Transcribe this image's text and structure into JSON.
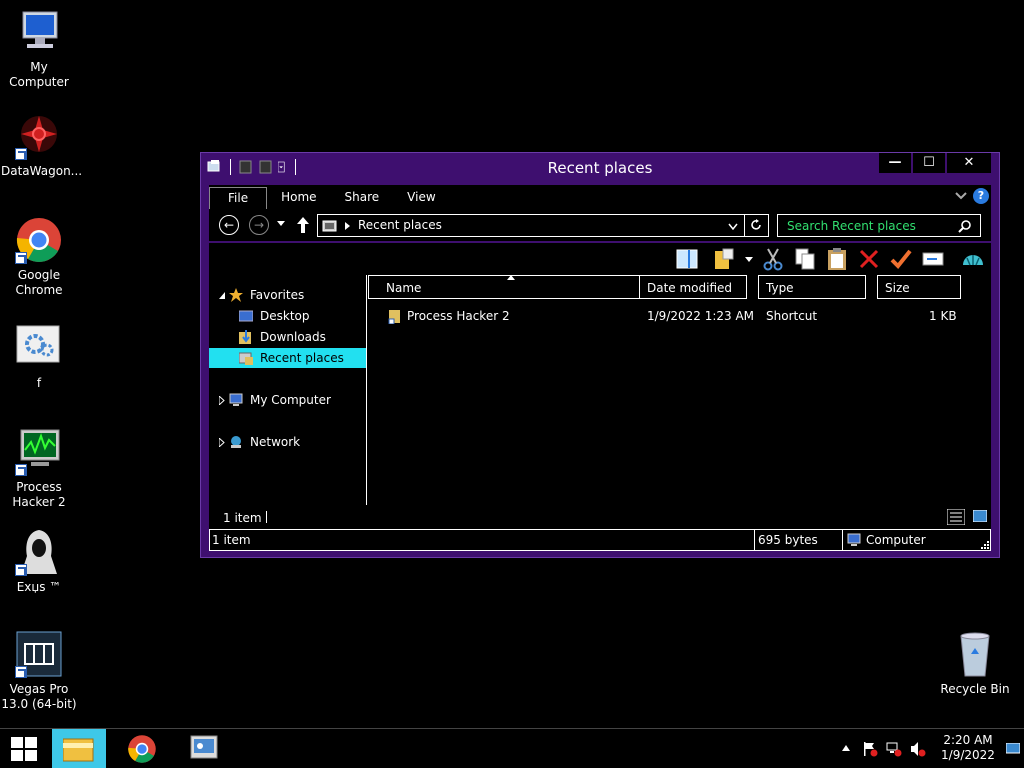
{
  "desktop": {
    "icons": [
      {
        "label": "My Computer"
      },
      {
        "label": "DataWagon..."
      },
      {
        "label": "Google Chrome"
      },
      {
        "label": "f"
      },
      {
        "label": "Process Hacker 2"
      },
      {
        "label": "Exџs ™"
      },
      {
        "label": "Vegas Pro 13.0 (64-bit)"
      },
      {
        "label": "Recycle Bin"
      }
    ]
  },
  "window": {
    "title": "Recent places",
    "controls": {
      "minimize": "—",
      "maximize": "☐",
      "close": "✕"
    },
    "ribbon_tabs": [
      "File",
      "Home",
      "Share",
      "View"
    ],
    "address": {
      "location": "Recent places"
    },
    "search": {
      "placeholder": "Search Recent places"
    },
    "nav": {
      "favorites": "Favorites",
      "desktop": "Desktop",
      "downloads": "Downloads",
      "recent_places": "Recent places",
      "my_computer": "My Computer",
      "network": "Network"
    },
    "columns": [
      "Name",
      "Date modified",
      "Type",
      "Size"
    ],
    "files": [
      {
        "name": "Process Hacker 2",
        "date_modified": "1/9/2022 1:23 AM",
        "type": "Shortcut",
        "size": "1 KB"
      }
    ],
    "status": {
      "item_count": "1 item"
    },
    "details_bar": {
      "items": "1 item",
      "size": "695 bytes",
      "location": "Computer"
    }
  },
  "taskbar": {
    "clock": {
      "time": "2:20 AM",
      "date": "1/9/2022"
    }
  },
  "colors": {
    "window_frame": "#3e0f6f",
    "selection": "#22e0f0",
    "search_text": "#32e070",
    "taskbar_active": "#3ec8e8"
  }
}
